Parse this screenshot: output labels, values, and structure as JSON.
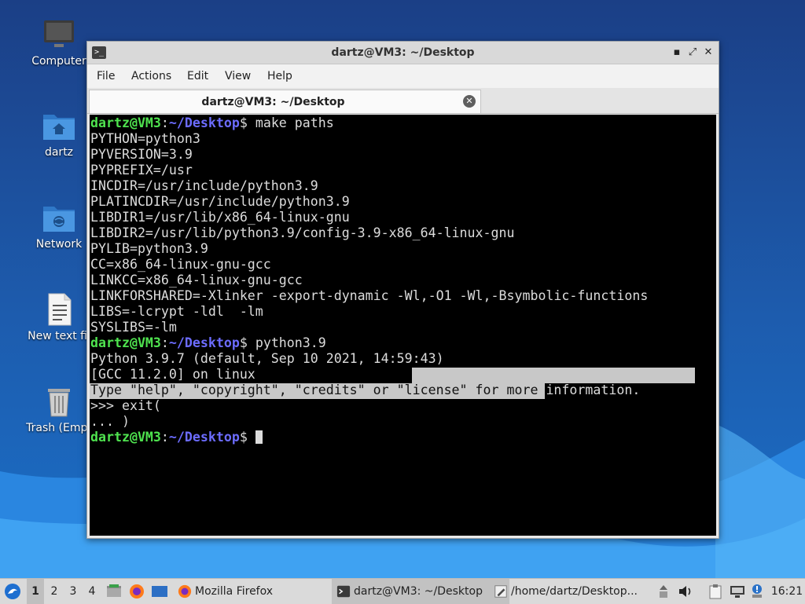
{
  "desktop": {
    "icons": [
      {
        "label": "Computer",
        "icon": "computer-icon"
      },
      {
        "label": "dartz",
        "icon": "home-folder-icon"
      },
      {
        "label": "Network",
        "icon": "network-folder-icon"
      },
      {
        "label": "New text fil",
        "icon": "text-file-icon"
      },
      {
        "label": "Trash (Empt",
        "icon": "trash-icon"
      }
    ]
  },
  "window": {
    "title": "dartz@VM3: ~/Desktop",
    "menu": [
      "File",
      "Actions",
      "Edit",
      "View",
      "Help"
    ],
    "tab_label": "dartz@VM3: ~/Desktop",
    "controls": {
      "minimize": "▪",
      "maximize": "⤢",
      "close": "✕"
    }
  },
  "terminal": {
    "prompt_user": "dartz@VM3",
    "prompt_sep": ":",
    "prompt_path": "~/Desktop",
    "prompt_end": "$",
    "cmd1": " make paths",
    "output1": [
      "PYTHON=python3",
      "PYVERSION=3.9",
      "PYPREFIX=/usr",
      "INCDIR=/usr/include/python3.9",
      "PLATINCDIR=/usr/include/python3.9",
      "LIBDIR1=/usr/lib/x86_64-linux-gnu",
      "LIBDIR2=/usr/lib/python3.9/config-3.9-x86_64-linux-gnu",
      "PYLIB=python3.9",
      "CC=x86_64-linux-gnu-gcc",
      "LINKCC=x86_64-linux-gnu-gcc",
      "LINKFORSHARED=-Xlinker -export-dynamic -Wl,-O1 -Wl,-Bsymbolic-functions",
      "LIBS=-lcrypt -ldl  -lm",
      "SYSLIBS=-lm"
    ],
    "cmd2": " python3.9",
    "py_banner1": "Python 3.9.7 (default, Sep 10 2021, 14:59:43)",
    "py_banner2": "[GCC 11.2.0] on linux",
    "py_banner3_sel": "Type \"help\", \"copyright\", \"credits\" or \"license\" for more ",
    "py_banner3_rest": "information.",
    "py_in1": ">>> exit(",
    "py_in2": "... )"
  },
  "taskbar": {
    "workspaces": [
      "1",
      "2",
      "3",
      "4"
    ],
    "tasks": [
      {
        "label": "Mozilla Firefox",
        "icon": "firefox-icon"
      },
      {
        "label": "dartz@VM3: ~/Desktop",
        "icon": "terminal-icon"
      },
      {
        "label": "/home/dartz/Desktop...",
        "icon": "text-editor-icon"
      }
    ],
    "clock": "16:21"
  },
  "colors": {
    "prompt_user": "#4fe34f",
    "prompt_path": "#6c6cff",
    "terminal_bg": "#000000",
    "selection": "#c8c8c8"
  }
}
